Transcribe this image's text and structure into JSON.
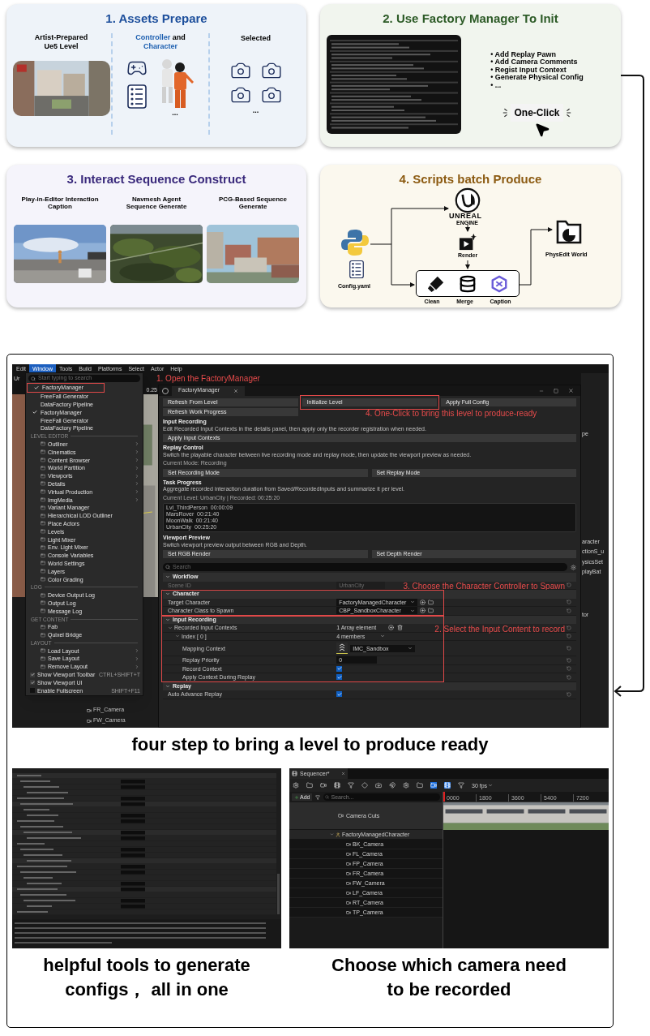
{
  "step1": {
    "title": "1. Assets Prepare",
    "level_label": "Artist-Prepared Ue5 Level",
    "controller_label": [
      {
        "text": "Controller",
        "highlight": true
      },
      {
        "text": " and ",
        "highlight": false
      },
      {
        "text": "Character",
        "highlight": true
      }
    ],
    "controller_more": "...",
    "selected_label": "Selected",
    "selected_more": "..."
  },
  "step2": {
    "title": "2. Use Factory Manager To Init",
    "bullets": [
      "• Add Replay Pawn",
      "• Add Camera Comments",
      "• Regist Input Context",
      "• Generate Physical Config",
      "• ..."
    ],
    "action": "One-Click"
  },
  "step3": {
    "title": "3. Interact Sequence Construct",
    "panels": [
      {
        "label": "Play-in-Editor Interaction Caption",
        "kind": "plain"
      },
      {
        "label": "Navmesh Agent Sequence Generate",
        "kind": "forest"
      },
      {
        "label": "PCG-Based Sequence Generate",
        "kind": "city"
      }
    ]
  },
  "step4": {
    "title": "4. Scripts batch Produce",
    "engine_name": "UNREAL",
    "engine_sub": "ENGINE",
    "render": "Render",
    "config": "Config.yaml",
    "stages": [
      "Clean",
      "Merge",
      "Caption"
    ],
    "output": "PhysEdit World"
  },
  "editor": {
    "menu": [
      {
        "label": "Edit",
        "selected": false
      },
      {
        "label": "Window",
        "selected": true
      },
      {
        "label": "Tools",
        "selected": false
      },
      {
        "label": "Build",
        "selected": false
      },
      {
        "label": "Platforms",
        "selected": false
      },
      {
        "label": "Select",
        "selected": false
      },
      {
        "label": "Actor",
        "selected": false
      },
      {
        "label": "Help",
        "selected": false
      }
    ],
    "toolbar_fragments": [
      "Ur",
      "0.25"
    ],
    "camera_rows": [
      "FR_Camera",
      "FW_Camera"
    ],
    "menu_search_placeholder": "Start typing to search",
    "menu_items": [
      {
        "kind": "tool",
        "label": "FactoryManager",
        "checked": true
      },
      {
        "kind": "tool",
        "label": "FreeFall Generator",
        "checked": false
      },
      {
        "kind": "tool",
        "label": "DataFactory Pipeline",
        "checked": false
      },
      {
        "kind": "tool",
        "label": "FactoryManager",
        "checked": true
      },
      {
        "kind": "tool",
        "label": "FreeFall Generator",
        "checked": false
      },
      {
        "kind": "tool",
        "label": "DataFactory Pipeline",
        "checked": false
      },
      {
        "kind": "heading",
        "label": "LEVEL EDITOR"
      },
      {
        "kind": "item",
        "label": "Outliner",
        "submenu": true
      },
      {
        "kind": "item",
        "label": "Cinematics",
        "submenu": true
      },
      {
        "kind": "item",
        "label": "Content Browser",
        "submenu": true
      },
      {
        "kind": "item",
        "label": "World Partition",
        "submenu": true
      },
      {
        "kind": "item",
        "label": "Viewports",
        "submenu": true
      },
      {
        "kind": "item",
        "label": "Details",
        "submenu": true
      },
      {
        "kind": "item",
        "label": "Virtual Production",
        "submenu": true
      },
      {
        "kind": "item",
        "label": "ImgMedia",
        "submenu": true
      },
      {
        "kind": "item",
        "label": "Variant Manager",
        "submenu": false
      },
      {
        "kind": "item",
        "label": "Hierarchical LOD Outliner",
        "submenu": false
      },
      {
        "kind": "item",
        "label": "Place Actors",
        "submenu": false
      },
      {
        "kind": "item",
        "label": "Levels",
        "submenu": false
      },
      {
        "kind": "item",
        "label": "Light Mixer",
        "submenu": false
      },
      {
        "kind": "item",
        "label": "Env. Light Mixer",
        "submenu": false
      },
      {
        "kind": "item",
        "label": "Console Variables",
        "submenu": false
      },
      {
        "kind": "item",
        "label": "World Settings",
        "submenu": false
      },
      {
        "kind": "item",
        "label": "Layers",
        "submenu": false
      },
      {
        "kind": "item",
        "label": "Color Grading",
        "submenu": false
      },
      {
        "kind": "heading",
        "label": "LOG"
      },
      {
        "kind": "item",
        "label": "Device Output Log",
        "submenu": false
      },
      {
        "kind": "item",
        "label": "Output Log",
        "submenu": false
      },
      {
        "kind": "item",
        "label": "Message Log",
        "submenu": false
      },
      {
        "kind": "heading",
        "label": "GET CONTENT"
      },
      {
        "kind": "item",
        "label": "Fab",
        "submenu": false
      },
      {
        "kind": "item",
        "label": "Quixel Bridge",
        "submenu": false
      },
      {
        "kind": "heading",
        "label": "LAYOUT"
      },
      {
        "kind": "item",
        "label": "Load Layout",
        "submenu": true
      },
      {
        "kind": "item",
        "label": "Save Layout",
        "submenu": true
      },
      {
        "kind": "item",
        "label": "Remove Layout",
        "submenu": true
      },
      {
        "kind": "toggle",
        "label": "Show Viewport Toolbar",
        "checked": true,
        "shortcut": "CTRL+SHIFT+T"
      },
      {
        "kind": "toggle",
        "label": "Show Viewport UI",
        "checked": true
      },
      {
        "kind": "toggle",
        "label": "Enable Fullscreen",
        "checked": false,
        "shortcut": "SHIFT+F11"
      }
    ],
    "panel": {
      "tab": "FactoryManager",
      "blocks": [
        {
          "kind": "buttons",
          "buttons": [
            "Refresh From Level",
            "Initialize Level",
            "Apply Full Config"
          ]
        },
        {
          "kind": "buttons",
          "full_width": false,
          "buttons": [
            "Refresh Work Progress"
          ]
        },
        {
          "kind": "section",
          "title": "Input Recording",
          "description": "Edit Recorded Input Contexts in the details panel, then apply only the recorder registration when needed."
        },
        {
          "kind": "buttons",
          "full_width": true,
          "buttons": [
            "Apply Input Contexts"
          ]
        },
        {
          "kind": "section",
          "title": "Replay Control",
          "description": "Switch the playable character between live recording mode and replay mode, then update the viewport preview as needed."
        },
        {
          "kind": "status",
          "text": "Current Mode: Recording"
        },
        {
          "kind": "buttons",
          "buttons": [
            "Set Recording Mode",
            "Set Replay Mode"
          ]
        },
        {
          "kind": "section",
          "title": "Task Progress",
          "description": "Aggregate recorded interaction duration from Saved/RecordedInputs and summarize it per level."
        },
        {
          "kind": "status",
          "text": "Current Level: UrbanCity | Recorded: 00:25:20"
        },
        {
          "kind": "log",
          "lines": [
            "Lvl_ThirdPerson  00:00:09",
            "MarsRover  00:21:40",
            "MoonWalk  00:21:40",
            "UrbanCity  00:25:20"
          ]
        },
        {
          "kind": "section",
          "title": "Viewport Preview",
          "description": "Switch viewport preview output between RGB and Depth."
        },
        {
          "kind": "buttons",
          "buttons": [
            "Set RGB Render",
            "Set Depth Render"
          ]
        }
      ],
      "search_placeholder": "Search",
      "categories": [
        {
          "label": "Workflow",
          "expanded": true,
          "children": [
            {
              "label": "Scene ID",
              "kind": "text",
              "value": "UrbanCity",
              "disabled": true
            }
          ]
        },
        {
          "label": "Character",
          "expanded": true,
          "children": [
            {
              "label": "Target Character",
              "kind": "dropdown",
              "value": "FactoryManagedCharacter",
              "disabled": false
            },
            {
              "label": "Character Class to Spawn",
              "kind": "dropdown",
              "value": "CBP_SandboxCharacter",
              "disabled": false
            }
          ]
        },
        {
          "label": "Input Recording",
          "expanded": true,
          "children": [
            {
              "label": "Recorded Input Contexts",
              "kind": "array",
              "value": "1 Array element",
              "disabled": false,
              "expanded": true,
              "children": [
                {
                  "label": "Index [ 0 ]",
                  "kind": "members",
                  "value": "4 members",
                  "disabled": false,
                  "expanded": true,
                  "children": [
                    {
                      "label": "Mapping Context",
                      "kind": "asset",
                      "value": "IMC_Sandbox",
                      "disabled": false
                    },
                    {
                      "label": "Replay Priority",
                      "kind": "number",
                      "value": "0",
                      "disabled": false
                    },
                    {
                      "label": "Record Context",
                      "kind": "checkbox",
                      "checked": true,
                      "disabled": false
                    },
                    {
                      "label": "Apply Context During Replay",
                      "kind": "checkbox",
                      "checked": true,
                      "disabled": false
                    }
                  ]
                }
              ]
            }
          ]
        },
        {
          "label": "Replay",
          "expanded": true,
          "children": [
            {
              "label": "Auto Advance Replay",
              "kind": "checkbox",
              "checked": true,
              "disabled": false
            }
          ]
        }
      ]
    },
    "right_fragments": [
      "pe",
      "aracter",
      "ctionS_u",
      "ysicsSet",
      "playBat",
      "tor"
    ],
    "annotations": [
      "1. Open the FactoryManager",
      "4. One-Click to bring this level to produce-ready",
      "3. Choose the Character Controller to Spawn",
      "2. Select the Input Content to record"
    ]
  },
  "caption_main": "four step to bring a level to produce ready",
  "sequencer": {
    "tab": "Sequencer*",
    "fps": "30 fps",
    "add": "Add",
    "search_placeholder": "Search...",
    "ruler": [
      "0000",
      "1800",
      "3600",
      "5400",
      "7200"
    ],
    "tracks": [
      {
        "kind": "cuts",
        "label": "Camera Cuts"
      },
      {
        "kind": "actor",
        "label": "FactoryManagedCharacter",
        "expanded": true,
        "children": [
          {
            "label": "BK_Camera"
          },
          {
            "label": "FL_Camera"
          },
          {
            "label": "FP_Camera"
          },
          {
            "label": "FR_Camera"
          },
          {
            "label": "FW_Camera"
          },
          {
            "label": "LF_Camera"
          },
          {
            "label": "RT_Camera"
          },
          {
            "label": "TP_Camera"
          }
        ]
      }
    ]
  },
  "caption_left": "helpful tools to generate configs，  all in one",
  "caption_right": "Choose which camera need to be recorded"
}
